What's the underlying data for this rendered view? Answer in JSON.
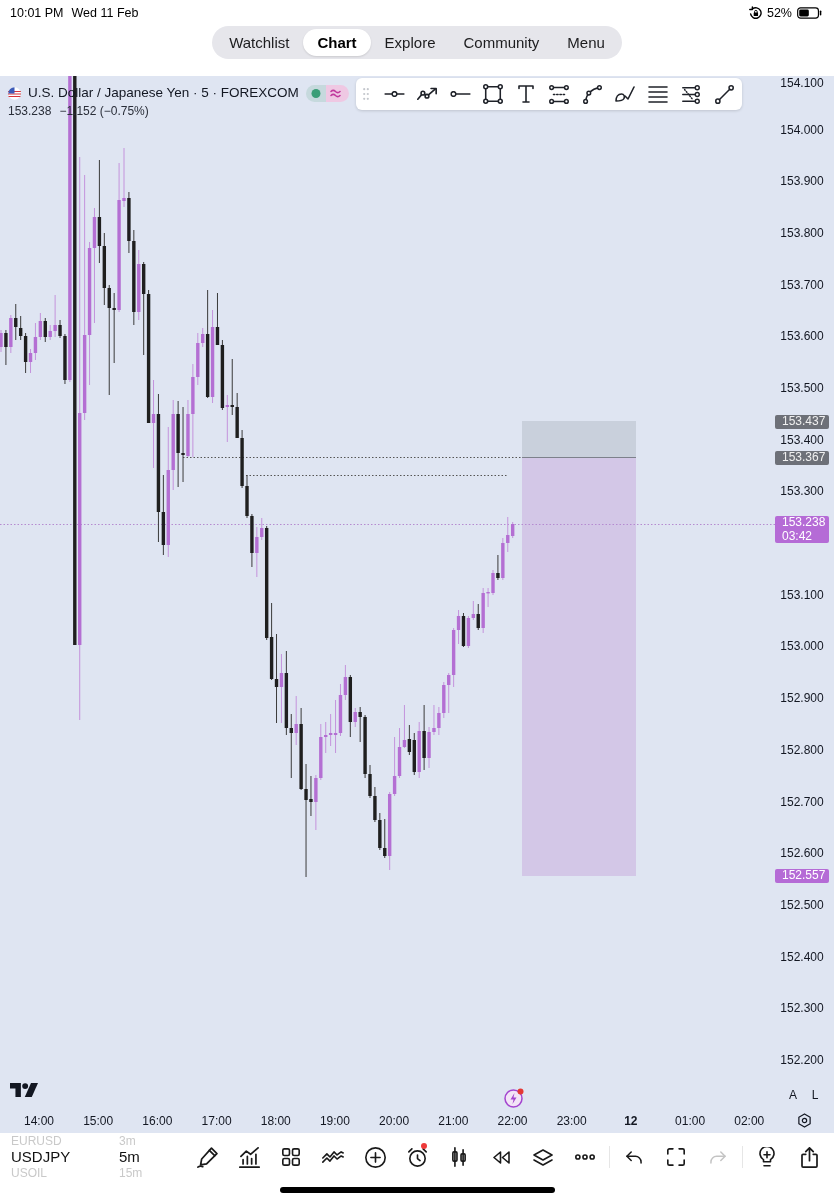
{
  "status_bar": {
    "time": "10:01 PM",
    "date": "Wed 11 Feb",
    "battery": "52%"
  },
  "nav_tabs": [
    {
      "label": "Watchlist",
      "selected": false
    },
    {
      "label": "Chart",
      "selected": true
    },
    {
      "label": "Explore",
      "selected": false
    },
    {
      "label": "Community",
      "selected": false
    },
    {
      "label": "Menu",
      "selected": false
    }
  ],
  "legend": {
    "title": "U.S. Dollar / Japanese Yen · 5 · FOREXCOM",
    "last_price": "153.238",
    "change": "−1.152 (−0.75%)"
  },
  "drawing_tools": [
    {
      "kind": "horizontal_line"
    },
    {
      "kind": "path"
    },
    {
      "kind": "ray"
    },
    {
      "kind": "rectangle"
    },
    {
      "kind": "text"
    },
    {
      "kind": "channel"
    },
    {
      "kind": "curve"
    },
    {
      "kind": "brush"
    },
    {
      "kind": "lines"
    },
    {
      "kind": "fib"
    },
    {
      "kind": "trend_line"
    }
  ],
  "price_axis": [
    "154.100",
    "154.000",
    "153.900",
    "153.800",
    "153.700",
    "153.600",
    "153.500",
    "153.400",
    "153.300",
    "153.100",
    "153.000",
    "152.900",
    "152.800",
    "152.700",
    "152.600",
    "152.500",
    "152.400",
    "152.300",
    "152.200"
  ],
  "price_badges": [
    {
      "kind": "level",
      "price": "153.437"
    },
    {
      "kind": "level",
      "price": "153.367"
    },
    {
      "kind": "current",
      "price": "153.238",
      "timer": "03:42"
    },
    {
      "kind": "target",
      "price": "152.557"
    }
  ],
  "scale_buttons": [
    "A",
    "L"
  ],
  "time_axis": [
    {
      "label": "14:00",
      "kind": "time"
    },
    {
      "label": "15:00",
      "kind": "time"
    },
    {
      "label": "16:00",
      "kind": "time"
    },
    {
      "label": "17:00",
      "kind": "time"
    },
    {
      "label": "18:00",
      "kind": "time"
    },
    {
      "label": "19:00",
      "kind": "time"
    },
    {
      "label": "20:00",
      "kind": "time"
    },
    {
      "label": "21:00",
      "kind": "time"
    },
    {
      "label": "22:00",
      "kind": "time"
    },
    {
      "label": "23:00",
      "kind": "time"
    },
    {
      "label": "12",
      "kind": "day"
    },
    {
      "label": "01:00",
      "kind": "time"
    },
    {
      "label": "02:00",
      "kind": "time"
    }
  ],
  "symbol_picker": {
    "symbols": [
      {
        "label": "EURUSD",
        "selected": false
      },
      {
        "label": "USDJPY",
        "selected": true
      },
      {
        "label": "USOIL",
        "selected": false
      }
    ],
    "intervals": [
      {
        "label": "3m",
        "selected": false
      },
      {
        "label": "5m",
        "selected": true
      },
      {
        "label": "15m",
        "selected": false
      }
    ]
  },
  "bottom_toolbar": {
    "groups": [
      [
        {
          "kind": "draw",
          "disabled": false,
          "badge": false
        },
        {
          "kind": "chart",
          "disabled": false,
          "badge": false
        },
        {
          "kind": "grid",
          "disabled": false,
          "badge": false
        },
        {
          "kind": "indicators",
          "disabled": false,
          "badge": false
        },
        {
          "kind": "add",
          "disabled": false,
          "badge": false
        },
        {
          "kind": "alert",
          "disabled": false,
          "badge": true
        },
        {
          "kind": "candles",
          "disabled": false,
          "badge": false
        },
        {
          "kind": "replay",
          "disabled": false,
          "badge": false
        },
        {
          "kind": "layers",
          "disabled": false,
          "badge": false
        },
        {
          "kind": "more",
          "disabled": false,
          "badge": false
        }
      ],
      [
        {
          "kind": "undo",
          "disabled": false,
          "badge": false
        },
        {
          "kind": "fullscreen",
          "disabled": false,
          "badge": false
        },
        {
          "kind": "redo",
          "disabled": true,
          "badge": false
        }
      ],
      [
        {
          "kind": "ideas",
          "disabled": false,
          "badge": false
        },
        {
          "kind": "share",
          "disabled": false,
          "badge": false
        }
      ]
    ]
  }
}
